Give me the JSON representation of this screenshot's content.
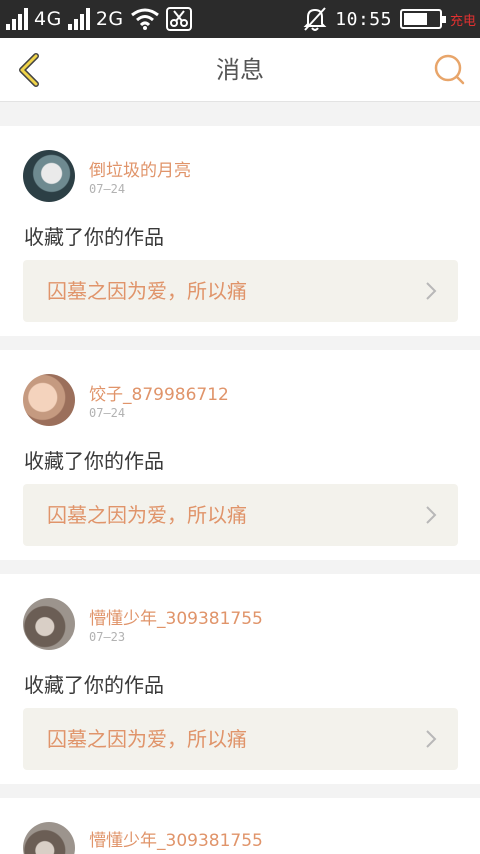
{
  "status_bar": {
    "network1": "4G",
    "network2": "2G",
    "time": "10:55",
    "battery_note": "充电"
  },
  "header": {
    "title": "消息",
    "accent_color": "#e0a060",
    "back_icon": "chevron-left-icon",
    "search_icon": "search-icon"
  },
  "messages": [
    {
      "user": "倒垃圾的月亮",
      "date": "07—24",
      "action": "收藏了你的作品",
      "work": "囚墓之因为爱，所以痛"
    },
    {
      "user": "饺子_879986712",
      "date": "07—24",
      "action": "收藏了你的作品",
      "work": "囚墓之因为爱，所以痛"
    },
    {
      "user": "懵懂少年_309381755",
      "date": "07—23",
      "action": "收藏了你的作品",
      "work": "囚墓之因为爱，所以痛"
    },
    {
      "user": "懵懂少年_309381755"
    }
  ]
}
